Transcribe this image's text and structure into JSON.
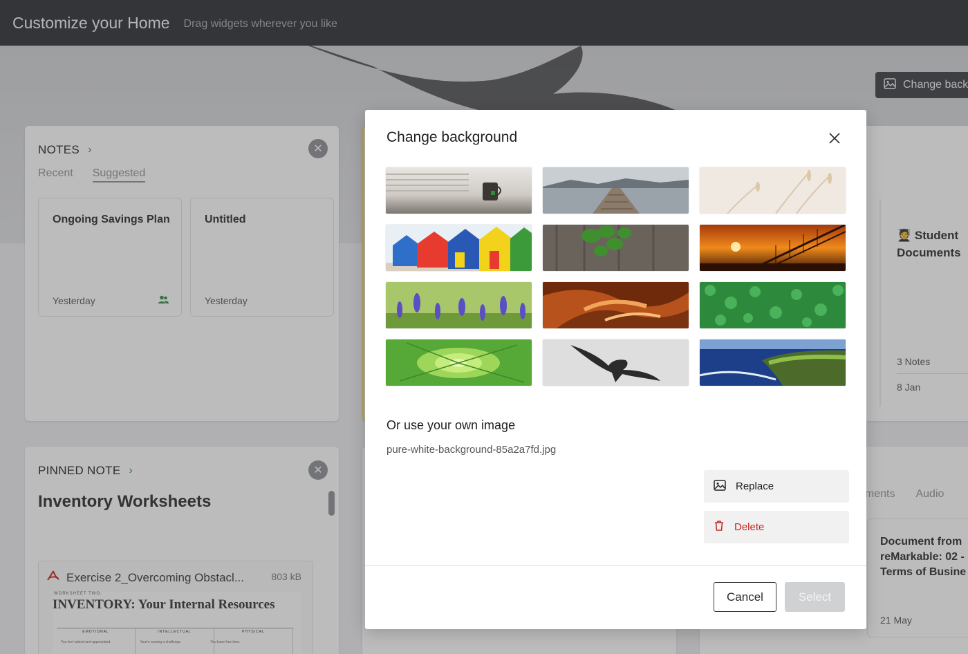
{
  "topbar": {
    "title": "Customize your Home",
    "subtitle": "Drag widgets wherever you like"
  },
  "page_button": {
    "label": "Change back",
    "icon": "image-icon"
  },
  "notes_widget": {
    "header": "NOTES",
    "tabs": [
      "Recent",
      "Suggested"
    ],
    "active_tab": "Suggested",
    "cards": [
      {
        "title": "Ongoing Savings Plan",
        "date": "Yesterday",
        "shared": true
      },
      {
        "title": "Untitled",
        "date": "Yesterday",
        "shared": false
      }
    ]
  },
  "pinned_widget": {
    "header": "PINNED NOTE",
    "title": "Inventory Worksheets",
    "attachment": {
      "name": "Exercise 2_Overcoming Obstacl...",
      "size": "803 kB",
      "preview_label": "WORKSHEET TWO:",
      "preview_title": "INVENTORY: Your Internal Resources",
      "preview_columns": [
        "EMOTIONAL",
        "INTELLECTUAL",
        "PHYSICAL"
      ],
      "preview_rows": [
        "You feel valued and appreciated.",
        "You're craving a challenge.",
        "You have free time."
      ]
    }
  },
  "right_widget_1": {
    "title": "🧑‍🎓 Student Documents",
    "count": "3 Notes",
    "date": "8 Jan"
  },
  "right_widget_2": {
    "tabs": [
      "uments",
      "Audio"
    ],
    "card_title": "Document from reMarkable: 02 - Terms of Busine",
    "card_date": "21 May"
  },
  "modal": {
    "title": "Change background",
    "own_image_title": "Or use your own image",
    "file_name": "pure-white-background-85a2a7fd.jpg",
    "replace_label": "Replace",
    "delete_label": "Delete",
    "cancel_label": "Cancel",
    "select_label": "Select",
    "delete_color": "#c3261f"
  }
}
